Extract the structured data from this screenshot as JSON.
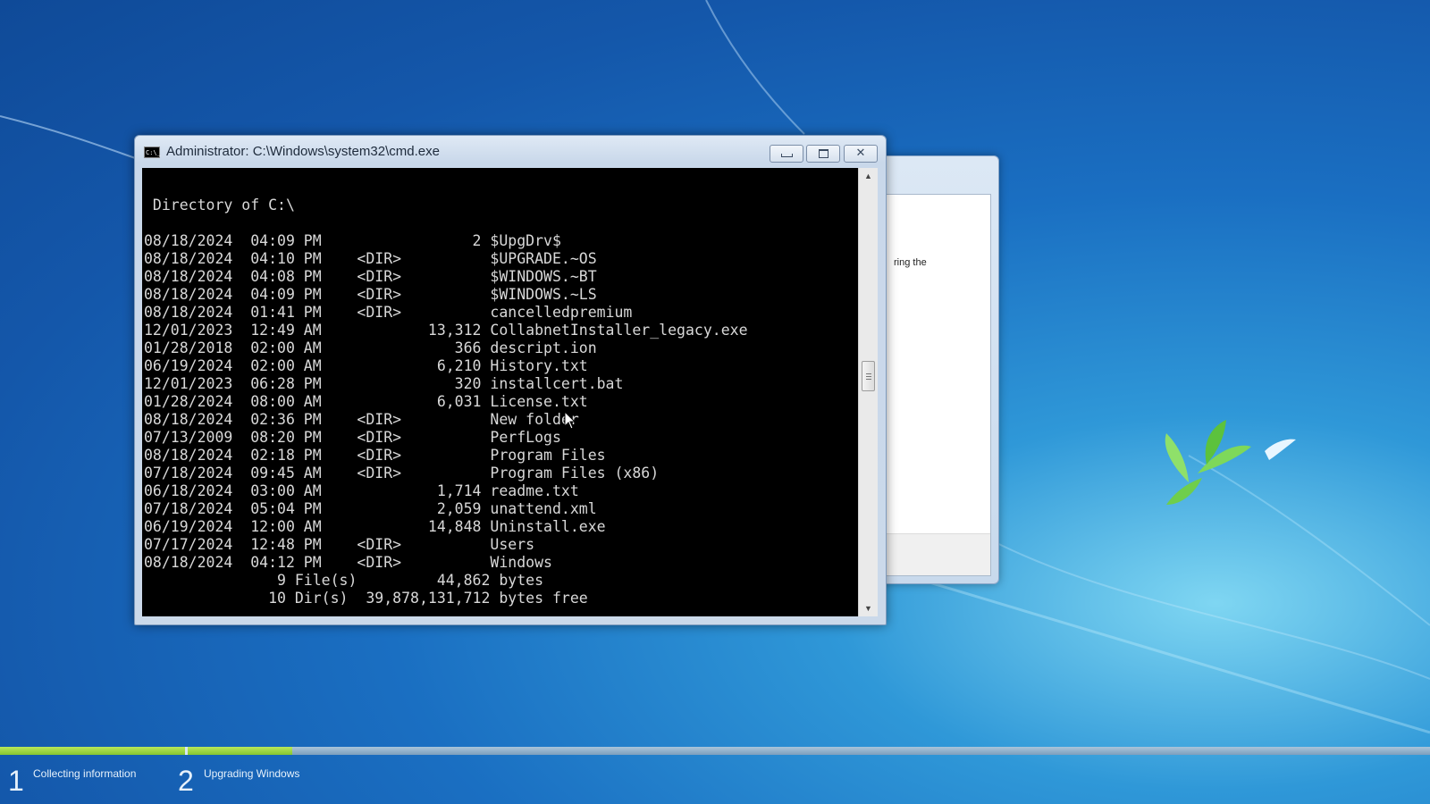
{
  "cmd_window": {
    "title": "Administrator: C:\\Windows\\system32\\cmd.exe",
    "icon": "cmd-icon",
    "icon_text": "C:\\_",
    "buttons": {
      "minimize": "minimize-icon",
      "maximize": "maximize-icon",
      "close": "close-icon",
      "close_glyph": "✕"
    },
    "scrollbar": {
      "up_arrow": "▲",
      "down_arrow": "▼"
    },
    "console_output": "\n Directory of C:\\\n\n08/18/2024  04:09 PM                 2 $UpgDrv$\n08/18/2024  04:10 PM    <DIR>          $UPGRADE.~OS\n08/18/2024  04:08 PM    <DIR>          $WINDOWS.~BT\n08/18/2024  04:09 PM    <DIR>          $WINDOWS.~LS\n08/18/2024  01:41 PM    <DIR>          cancelledpremium\n12/01/2023  12:49 AM            13,312 CollabnetInstaller_legacy.exe\n01/28/2018  02:00 AM               366 descript.ion\n06/19/2024  02:00 AM             6,210 History.txt\n12/01/2023  06:28 PM               320 installcert.bat\n01/28/2024  08:00 AM             6,031 License.txt\n08/18/2024  02:36 PM    <DIR>          New folder\n07/13/2009  08:20 PM    <DIR>          PerfLogs\n08/18/2024  02:18 PM    <DIR>          Program Files\n07/18/2024  09:45 AM    <DIR>          Program Files (x86)\n06/18/2024  03:00 AM             1,714 readme.txt\n07/18/2024  05:04 PM             2,059 unattend.xml\n06/19/2024  12:00 AM            14,848 Uninstall.exe\n07/17/2024  12:48 PM    <DIR>          Users\n08/18/2024  04:12 PM    <DIR>          Windows\n               9 File(s)         44,862 bytes\n              10 Dir(s)  39,878,131,712 bytes free"
  },
  "setup_window": {
    "partial_text": "ring the"
  },
  "setup_progress": {
    "steps": [
      {
        "number": "1",
        "label": "Collecting information",
        "progress": 1.0
      },
      {
        "number": "2",
        "label": "Upgrading Windows",
        "progress": 0.09
      }
    ]
  },
  "mouse_cursor": "mouse-pointer-icon"
}
